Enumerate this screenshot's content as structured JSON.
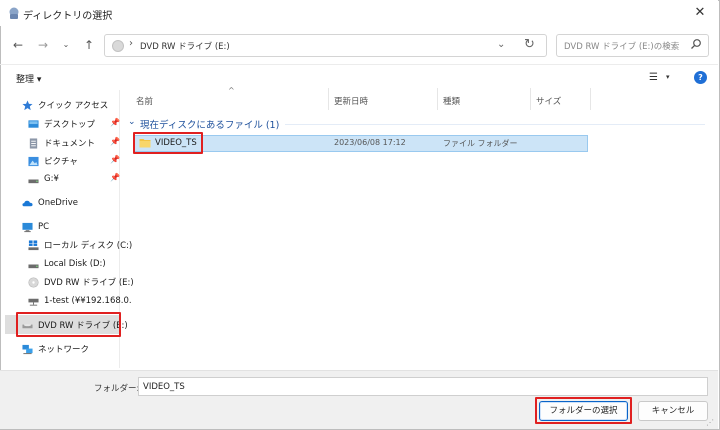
{
  "window": {
    "title": "ディレクトリの選択",
    "close_glyph": "✕"
  },
  "nav": {
    "back_glyph": "←",
    "forward_glyph": "→",
    "recent_glyph": "⌄",
    "up_glyph": "↑",
    "address_sep": "›",
    "address_path": "DVD RW ドライブ (E:)",
    "address_dropdown_glyph": "⌄",
    "refresh_glyph": "↻",
    "search_placeholder": "DVD RW ドライブ (E:)の検索"
  },
  "toolbar": {
    "organize_label": "整理 ▾",
    "view_glyph": "☰",
    "view_dropdown_glyph": "▾",
    "help_glyph": "?"
  },
  "sidebar": {
    "items": [
      {
        "label": "クイック アクセス",
        "icon": "star-icon"
      },
      {
        "label": "デスクトップ",
        "icon": "desktop-icon",
        "pin": "📌"
      },
      {
        "label": "ドキュメント",
        "icon": "document-icon",
        "pin": "📌"
      },
      {
        "label": "ピクチャ",
        "icon": "pictures-icon",
        "pin": "📌"
      },
      {
        "label": "G:¥",
        "icon": "drive-icon",
        "pin": "📌"
      },
      {
        "label": "OneDrive",
        "icon": "cloud-icon"
      },
      {
        "label": "PC",
        "icon": "pc-icon"
      },
      {
        "label": "ローカル ディスク (C:)",
        "icon": "windows-drive-icon"
      },
      {
        "label": "Local Disk (D:)",
        "icon": "drive-icon"
      },
      {
        "label": "DVD RW ドライブ (E:)",
        "icon": "disc-icon"
      },
      {
        "label": "1-test (¥¥192.168.0.",
        "icon": "network-drive-icon"
      },
      {
        "label": "DVD RW ドライブ (E:)",
        "icon": "disc-icon"
      },
      {
        "label": "ネットワーク",
        "icon": "network-icon"
      }
    ]
  },
  "list": {
    "columns": [
      "名前",
      "更新日時",
      "種類",
      "サイズ"
    ],
    "sort_glyph": "^",
    "group_chevron": "⌄",
    "group_label": "現在ディスクにあるファイル (1)",
    "rows": [
      {
        "name": "VIDEO_TS",
        "modified": "2023/06/08 17:12",
        "type": "ファイル フォルダー",
        "size": ""
      }
    ]
  },
  "footer": {
    "folder_label": "フォルダー:",
    "folder_value": "VIDEO_TS",
    "select_label": "フォルダーの選択",
    "cancel_label": "キャンセル",
    "grip_glyph": "⋰"
  },
  "colors": {
    "accent": "#1f6fd6",
    "selection_bg": "#cce4f7",
    "highlight_red": "#e02020",
    "folder_yellow": "#f3c443"
  }
}
